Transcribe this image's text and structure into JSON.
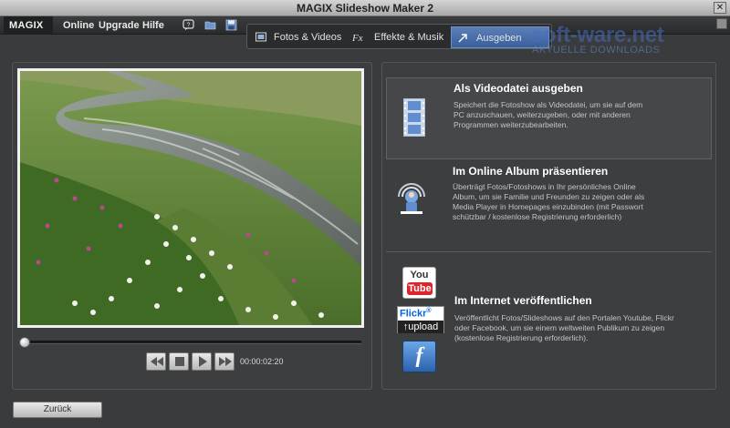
{
  "window": {
    "title": "MAGIX Slideshow Maker 2",
    "close_glyph": "✕"
  },
  "menubar": {
    "brand": "MAGIX",
    "items": [
      "Online",
      "Upgrade",
      "Hilfe"
    ],
    "toolbar_icons": [
      "help-icon",
      "open-folder-icon",
      "save-icon"
    ]
  },
  "mode_tabs": [
    {
      "label": "Fotos & Videos",
      "icon": "photo-icon",
      "active": false
    },
    {
      "label": "Effekte & Musik",
      "icon": "fx-icon",
      "active": false
    },
    {
      "label": "Ausgeben",
      "icon": "arrow-out-icon",
      "active": true
    }
  ],
  "watermark": {
    "main": "soft-ware.net",
    "sub": "AKTUELLE DOWNLOADS"
  },
  "player": {
    "time": "00:00:02:20",
    "position": 0.0
  },
  "options": [
    {
      "title": "Als Videodatei ausgeben",
      "icon": "film-strip-icon",
      "desc": [
        "Speichert die Fotoshow als Videodatei, um sie auf dem",
        "PC anzuschauen, weiterzugeben, oder mit anderen",
        "Programmen weiterzubearbeiten."
      ]
    },
    {
      "title": "Im Online Album präsentieren",
      "icon": "online-album-icon",
      "desc": [
        "Überträgt Fotos/Fotoshows in Ihr persönliches Online",
        "Album, um sie Familie und Freunden zu zeigen oder als",
        "Media Player in Homepages einzubinden (mit Passwort",
        "schützbar / kostenlose Registrierung erforderlich)"
      ]
    },
    {
      "title": "Im Internet veröffentlichen",
      "icon": "youtube-icon",
      "desc": [
        "Veröffentlicht Fotos/Slideshows auf den Portalen Youtube, Flickr",
        "oder Facebook, um sie einem weltweiten Publikum zu zeigen",
        "(kostenlose Registrierung erforderlich)."
      ],
      "logos": {
        "youtube_top": "You",
        "youtube_bottom": "Tube",
        "flickr_top": "Flickr",
        "flickr_reg": "®",
        "flickr_bottom": "upload",
        "third": "f"
      }
    }
  ],
  "back_button": "Zurück",
  "colors": {
    "accent": "#3a5f9a",
    "background": "#3a3b3d"
  }
}
